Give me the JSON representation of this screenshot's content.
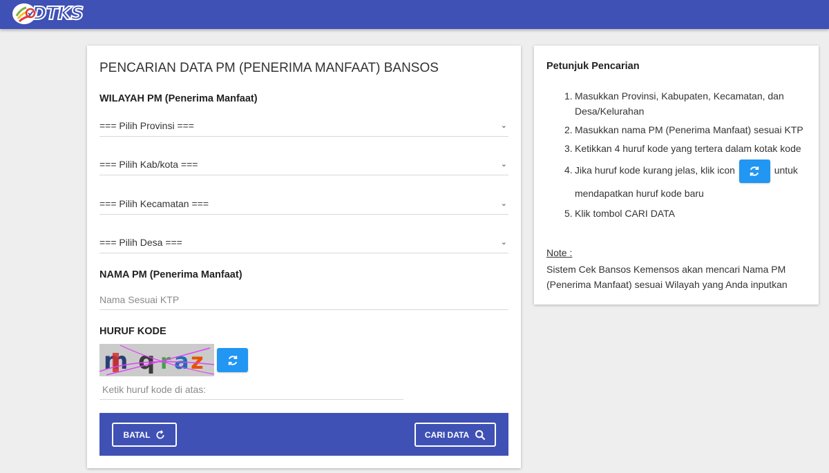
{
  "header": {
    "logo_text": "DTKS",
    "brand_color": "#3f51b5"
  },
  "search_form": {
    "title": "PENCARIAN DATA PM (PENERIMA MANFAAT) BANSOS",
    "region_label": "WILAYAH PM (Penerima Manfaat)",
    "selects": {
      "provinsi": "=== Pilih Provinsi ===",
      "kabkota": "=== Pilih Kab/kota ===",
      "kecamatan": "=== Pilih Kecamatan ===",
      "desa": "=== Pilih Desa ==="
    },
    "name_label": "NAMA PM (Penerima Manfaat)",
    "name_placeholder": "Nama Sesuai KTP",
    "code_label": "HURUF KODE",
    "captcha_text": "mqraz",
    "code_placeholder": "Ketik huruf kode di atas:",
    "cancel_label": "BATAL",
    "search_label": "CARI DATA",
    "accent_color": "#2196f3"
  },
  "guide": {
    "title": "Petunjuk Pencarian",
    "steps": [
      {
        "num": "1.",
        "text": "Masukkan Provinsi, Kabupaten, Kecamatan, dan Desa/Kelurahan"
      },
      {
        "num": "2.",
        "text": "Masukkan nama PM (Penerima Manfaat) sesuai KTP"
      },
      {
        "num": "3.",
        "text": "Ketikkan 4 huruf kode yang tertera dalam kotak kode"
      },
      {
        "num": "4.",
        "text_before": "Jika huruf kode kurang jelas, klik icon",
        "text_after": "untuk mendapatkan huruf kode baru"
      },
      {
        "num": "5.",
        "text": "Klik tombol CARI DATA"
      }
    ],
    "note_label": "Note :",
    "note_text": "Sistem Cek Bansos Kemensos akan mencari Nama PM (Penerima Manfaat) sesuai Wilayah yang Anda inputkan"
  }
}
